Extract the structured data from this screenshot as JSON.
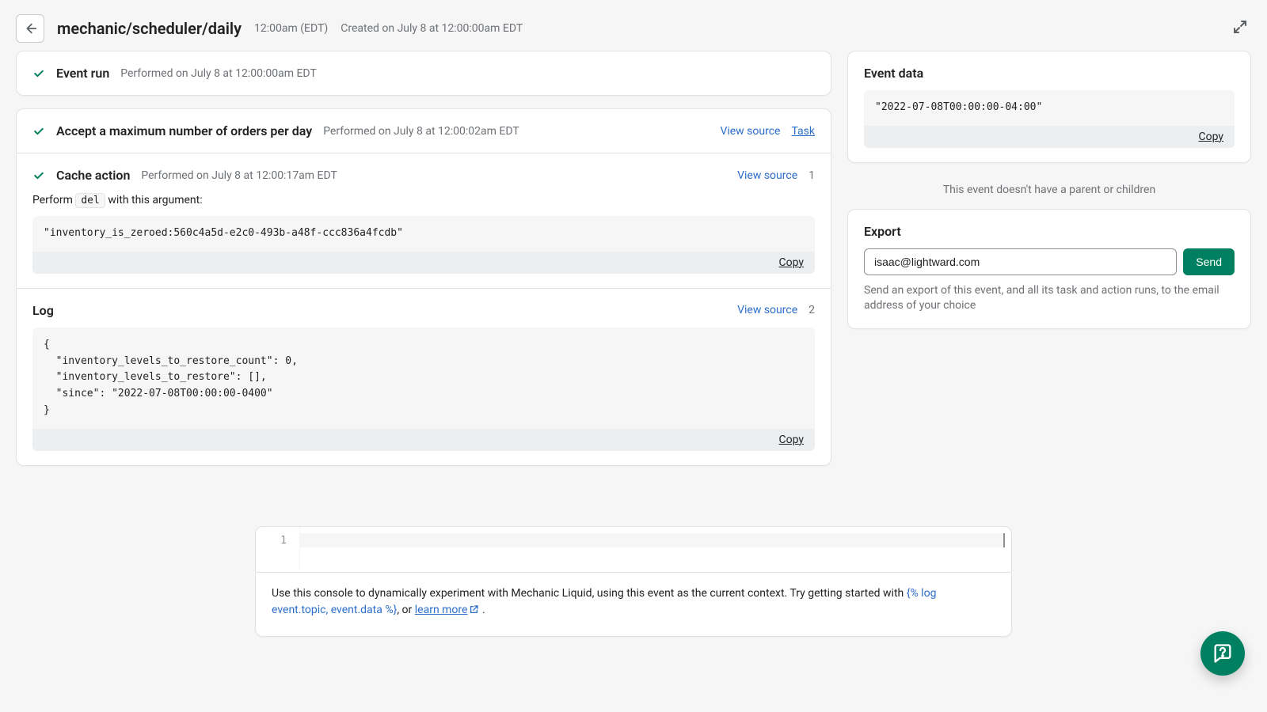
{
  "header": {
    "title": "mechanic/scheduler/daily",
    "time": "12:00am (EDT)",
    "created": "Created on July 8 at 12:00:00am EDT"
  },
  "event_run": {
    "title": "Event run",
    "performed": "Performed on July 8 at 12:00:00am EDT"
  },
  "task": {
    "title": "Accept a maximum number of orders per day",
    "performed": "Performed on July 8 at 12:00:02am EDT",
    "view_source": "View source",
    "task_link": "Task"
  },
  "cache_action": {
    "title": "Cache action",
    "performed": "Performed on July 8 at 12:00:17am EDT",
    "view_source": "View source",
    "count": "1",
    "perform_prefix": "Perform ",
    "perform_cmd": "del",
    "perform_suffix": " with this argument:",
    "argument": "\"inventory_is_zeroed:560c4a5d-e2c0-493b-a48f-ccc836a4fcdb\"",
    "copy": "Copy"
  },
  "log": {
    "title": "Log",
    "view_source": "View source",
    "count": "2",
    "body": "{\n  \"inventory_levels_to_restore_count\": 0,\n  \"inventory_levels_to_restore\": [],\n  \"since\": \"2022-07-08T00:00:00-0400\"\n}",
    "copy": "Copy"
  },
  "event_data": {
    "title": "Event data",
    "value": "\"2022-07-08T00:00:00-04:00\"",
    "copy": "Copy"
  },
  "parent_note": "This event doesn't have a parent or children",
  "export": {
    "title": "Export",
    "email": "isaac@lightward.com",
    "send": "Send",
    "help": "Send an export of this event, and all its task and action runs, to the email address of your choice"
  },
  "console": {
    "line_no": "1",
    "help_pre": "Use this console to dynamically experiment with Mechanic Liquid, using this event as the current context. Try getting started with ",
    "liquid": "{% log event.topic, event.data %}",
    "mid": ", or ",
    "learn": "learn more",
    "suffix": " ."
  }
}
